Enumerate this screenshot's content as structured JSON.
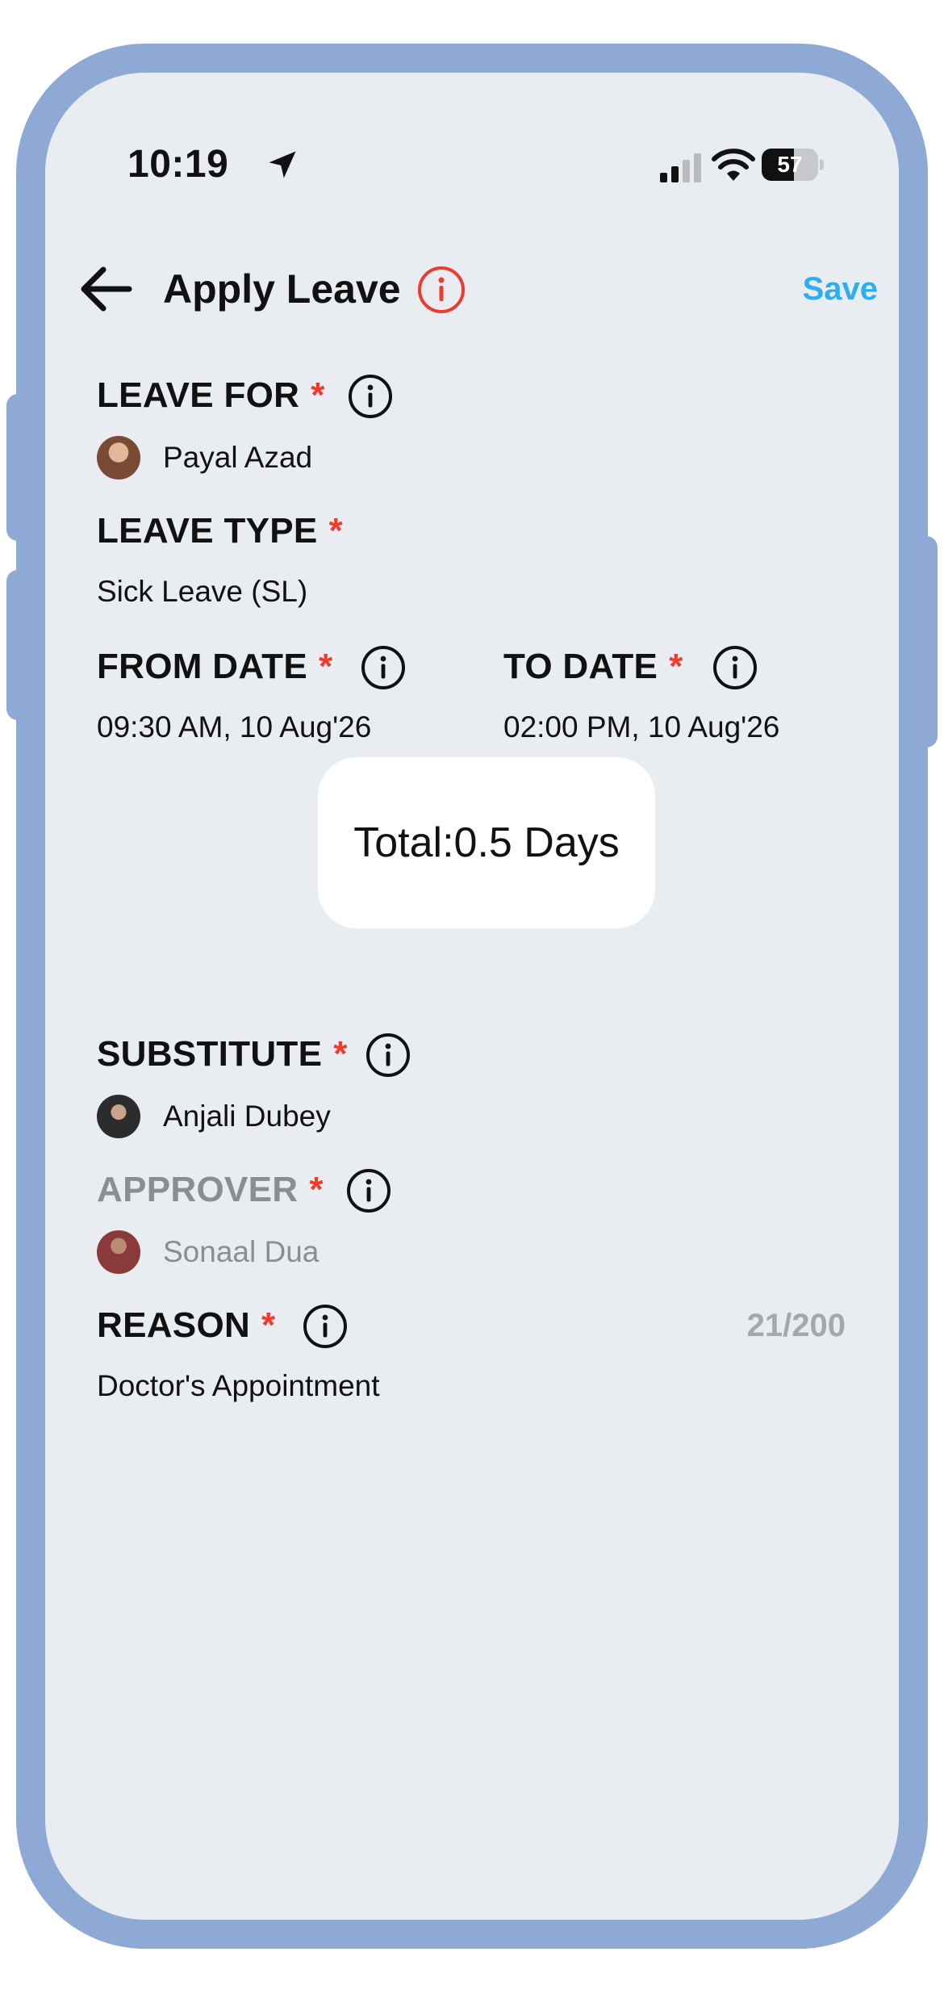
{
  "status_bar": {
    "time": "10:19",
    "battery_level": "57",
    "location_icon": "location-arrow-icon",
    "signal_icon": "cellular-signal-icon",
    "wifi_icon": "wifi-icon"
  },
  "header": {
    "title": "Apply Leave",
    "save_label": "Save",
    "back_icon": "back-arrow-icon",
    "info_icon": "info-icon"
  },
  "colors": {
    "accent": "#2eaef0",
    "required": "#ee3b2f",
    "frame": "#8fa9d6",
    "background": "#e9ecf0",
    "muted": "#8b8d90"
  },
  "form": {
    "leave_for": {
      "label": "LEAVE FOR",
      "required": "*",
      "value": "Payal Azad"
    },
    "leave_type": {
      "label": "LEAVE TYPE",
      "required": "*",
      "value": "Sick Leave (SL)"
    },
    "from_date": {
      "label": "FROM DATE",
      "required": "*",
      "value": "09:30 AM, 10 Aug'26"
    },
    "to_date": {
      "label": "TO DATE",
      "required": "*",
      "value": "02:00 PM, 10 Aug'26"
    },
    "total": "Total:0.5 Days",
    "substitute": {
      "label": "SUBSTITUTE",
      "required": "*",
      "value": "Anjali Dubey"
    },
    "approver": {
      "label": "APPROVER",
      "required": "*",
      "value": "Sonaal Dua"
    },
    "reason": {
      "label": "REASON",
      "required": "*",
      "value": "Doctor's Appointment",
      "char_count": "21/200"
    }
  }
}
